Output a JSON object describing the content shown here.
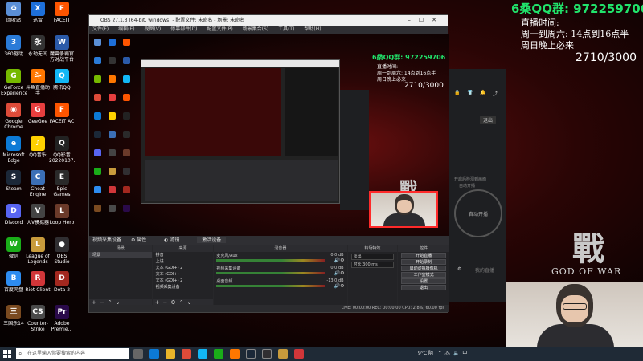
{
  "overlay": {
    "qq_group": "6桑QQ群: 972259706",
    "schedule": [
      "直播时间:",
      "周一到周六: 14点到16点半",
      "周日晚上必来"
    ],
    "counter": "2710/3000"
  },
  "desktop_icons": [
    {
      "label": "回收站",
      "icon": "recycle-bin-icon",
      "color": "#5b8fd6",
      "glyph": "♻"
    },
    {
      "label": "360驱动",
      "icon": "360-driver-icon",
      "color": "#2a7bd8",
      "glyph": "3"
    },
    {
      "label": "GeForce Experience",
      "icon": "geforce-icon",
      "color": "#76b900",
      "glyph": "G"
    },
    {
      "label": "Google Chrome",
      "icon": "chrome-icon",
      "color": "#dd4b39",
      "glyph": "◉"
    },
    {
      "label": "Microsoft Edge",
      "icon": "edge-icon",
      "color": "#0c7ad6",
      "glyph": "e"
    },
    {
      "label": "Steam",
      "icon": "steam-icon",
      "color": "#1b2838",
      "glyph": "S"
    },
    {
      "label": "Discord",
      "icon": "discord-icon",
      "color": "#5865f2",
      "glyph": "D"
    },
    {
      "label": "微信",
      "icon": "wechat-icon",
      "color": "#1aad19",
      "glyph": "W"
    },
    {
      "label": "百度网盘",
      "icon": "baidu-pan-icon",
      "color": "#2d8cf0",
      "glyph": "B"
    },
    {
      "label": "三国杀14",
      "icon": "sanguosha-icon",
      "color": "#7a4a20",
      "glyph": "三"
    },
    {
      "label": "迅雷",
      "icon": "xunlei-icon",
      "color": "#1e6fd9",
      "glyph": "X"
    },
    {
      "label": "永劫无间",
      "icon": "naraka-icon",
      "color": "#333333",
      "glyph": "永"
    },
    {
      "label": "斗鱼直播助手",
      "icon": "douyu-icon",
      "color": "#ff7700",
      "glyph": "斗"
    },
    {
      "label": "GeeGee",
      "icon": "geegee-icon",
      "color": "#e83e3e",
      "glyph": "G"
    },
    {
      "label": "QQ音乐",
      "icon": "qqmusic-icon",
      "color": "#ffd100",
      "glyph": "♪"
    },
    {
      "label": "Cheat Engine",
      "icon": "cheat-engine-icon",
      "color": "#3b6fb6",
      "glyph": "C"
    },
    {
      "label": "大V模拟器",
      "icon": "sim-icon",
      "color": "#444444",
      "glyph": "V"
    },
    {
      "label": "League of Legends",
      "icon": "lol-icon",
      "color": "#c89b3c",
      "glyph": "L"
    },
    {
      "label": "Riot Client",
      "icon": "riot-icon",
      "color": "#d13639",
      "glyph": "R"
    },
    {
      "label": "Counter-Strike Global Off...",
      "icon": "csgo-icon",
      "color": "#4a4a4a",
      "glyph": "CS"
    },
    {
      "label": "FACEIT",
      "icon": "faceit-icon",
      "color": "#ff5500",
      "glyph": "F"
    },
    {
      "label": "魔兽争霸官方对战平台",
      "icon": "warcraft-icon",
      "color": "#2b5aa8",
      "glyph": "W"
    },
    {
      "label": "腾讯QQ",
      "icon": "qq-icon",
      "color": "#12b7f5",
      "glyph": "Q"
    },
    {
      "label": "FACEIT AC",
      "icon": "faceit-ac-icon",
      "color": "#ff5500",
      "glyph": "F"
    },
    {
      "label": "QQ影音 20220107...",
      "icon": "qqplayer-icon",
      "color": "#222222",
      "glyph": "Q"
    },
    {
      "label": "Epic Games Launcher",
      "icon": "epic-icon",
      "color": "#2a2a2a",
      "glyph": "E"
    },
    {
      "label": "Loop Hero",
      "icon": "loophero-icon",
      "color": "#6b3a2a",
      "glyph": "L"
    },
    {
      "label": "OBS Studio",
      "icon": "obs-icon",
      "color": "#302e31",
      "glyph": "●"
    },
    {
      "label": "Dota 2",
      "icon": "dota-icon",
      "color": "#a3281f",
      "glyph": "D"
    },
    {
      "label": "Adobe Premie...",
      "icon": "premiere-icon",
      "color": "#2a0a4a",
      "glyph": "Pr"
    }
  ],
  "obs": {
    "title": "OBS 27.1.3 (64-bit, windows) - 配置文件: 未命名 - 场景: 未命名",
    "menu": [
      "文件(F)",
      "编辑(E)",
      "视图(V)",
      "停靠部件(D)",
      "配置文件(P)",
      "场景集合(S)",
      "工具(T)",
      "帮助(H)"
    ],
    "source_bar": [
      "视频采集设备",
      "属性",
      "滤镜",
      "激活设备"
    ],
    "docks": {
      "scenes": {
        "title": "场景",
        "items": [
          "场景"
        ]
      },
      "sources": {
        "title": "来源",
        "items": [
          "拼音",
          "上进",
          "文本 (GDI+) 2",
          "文本 (GDI+)",
          "文本 (GDI+) 2",
          "视频采集设备"
        ]
      },
      "mixer": {
        "title": "混音器",
        "rows": [
          {
            "name": "麦克风/Aux",
            "db": "0.0 dB"
          },
          {
            "name": "视频采集设备",
            "db": "0.0 dB"
          },
          {
            "name": "桌面音频",
            "db": "-13.0 dB"
          }
        ]
      },
      "transitions": {
        "title": "转场特效",
        "type": "淡出",
        "duration_label": "时长",
        "duration": "300 ms"
      },
      "controls": {
        "title": "控件",
        "buttons": [
          "开始直播",
          "开始录制",
          "启动虚拟摄像机",
          "工作室模式",
          "设置",
          "退出"
        ]
      }
    },
    "status": "LIVE: 00:00:00   REC: 00:00:00   CPU: 2.8%, 60.00 fps"
  },
  "side_app": {
    "button": "退出",
    "circle": "自动开播",
    "hint1": "开启后检测到画面",
    "hint2": "自动开播",
    "footer": "我的直播"
  },
  "art": {
    "big_char": "戰",
    "text": "GOD OF WAR"
  },
  "taskbar": {
    "search_placeholder": "在这里输入你要搜索的内容",
    "weather": "9°C 阴",
    "ime": "中",
    "time": "14:??"
  }
}
